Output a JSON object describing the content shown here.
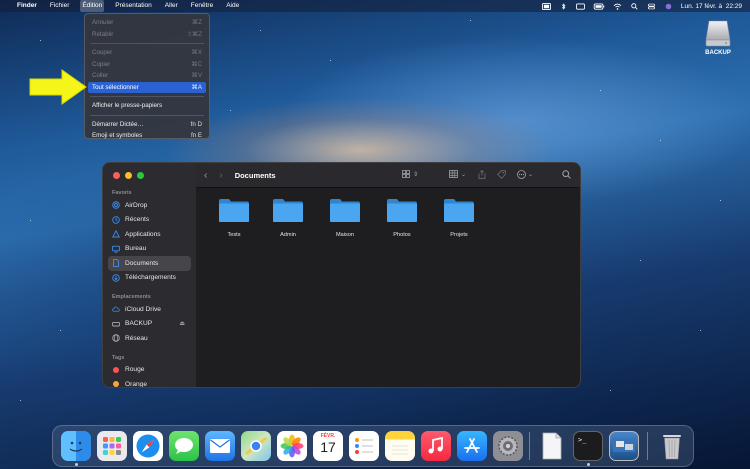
{
  "menubar": {
    "app_name": "Finder",
    "items": [
      "Fichier",
      "Édition",
      "Présentation",
      "Aller",
      "Fenêtre",
      "Aide"
    ],
    "clock": "Lun. 17 févr. à  22:29"
  },
  "edit_menu": {
    "items": [
      {
        "label": "Annuler",
        "shortcut": "⌘Z",
        "enabled": false
      },
      {
        "label": "Rétablir",
        "shortcut": "⇧⌘Z",
        "enabled": false
      },
      {
        "label": "Couper",
        "shortcut": "⌘X",
        "enabled": false
      },
      {
        "label": "Copier",
        "shortcut": "⌘C",
        "enabled": false
      },
      {
        "label": "Coller",
        "shortcut": "⌘V",
        "enabled": false
      },
      {
        "label": "Tout sélectionner",
        "shortcut": "⌘A",
        "enabled": true,
        "highlighted": true
      },
      {
        "label": "Afficher le presse-papiers",
        "shortcut": "",
        "enabled": true
      },
      {
        "label": "Démarrer Dictée…",
        "shortcut": "fn D",
        "enabled": true
      },
      {
        "label": "Emoji et symboles",
        "shortcut": "fn E",
        "enabled": true
      }
    ]
  },
  "desktop": {
    "disk_label": "BACKUP"
  },
  "finder": {
    "title": "Documents",
    "sidebar": {
      "favorites_heading": "Favoris",
      "favorites": [
        {
          "label": "AirDrop",
          "icon": "airdrop-icon"
        },
        {
          "label": "Récents",
          "icon": "clock-icon"
        },
        {
          "label": "Applications",
          "icon": "applications-icon"
        },
        {
          "label": "Bureau",
          "icon": "desktop-icon"
        },
        {
          "label": "Documents",
          "icon": "document-icon",
          "active": true
        },
        {
          "label": "Téléchargements",
          "icon": "download-icon"
        }
      ],
      "locations_heading": "Emplacements",
      "locations": [
        {
          "label": "iCloud Drive",
          "icon": "cloud-icon"
        },
        {
          "label": "BACKUP",
          "icon": "drive-icon"
        },
        {
          "label": "Réseau",
          "icon": "network-icon"
        }
      ],
      "tags_heading": "Tags",
      "tags": [
        {
          "label": "Rouge",
          "color": "#ff5257"
        },
        {
          "label": "Orange",
          "color": "#f6a53a"
        }
      ]
    },
    "files": [
      "Tests",
      "Admin",
      "Maison",
      "Photos",
      "Projets"
    ]
  },
  "dock": {
    "calendar_month": "FÉVR.",
    "calendar_day": "17"
  },
  "colors": {
    "accent": "#2a62d3",
    "folder": "#4aa6ee",
    "arrow": "#f5f51a"
  }
}
